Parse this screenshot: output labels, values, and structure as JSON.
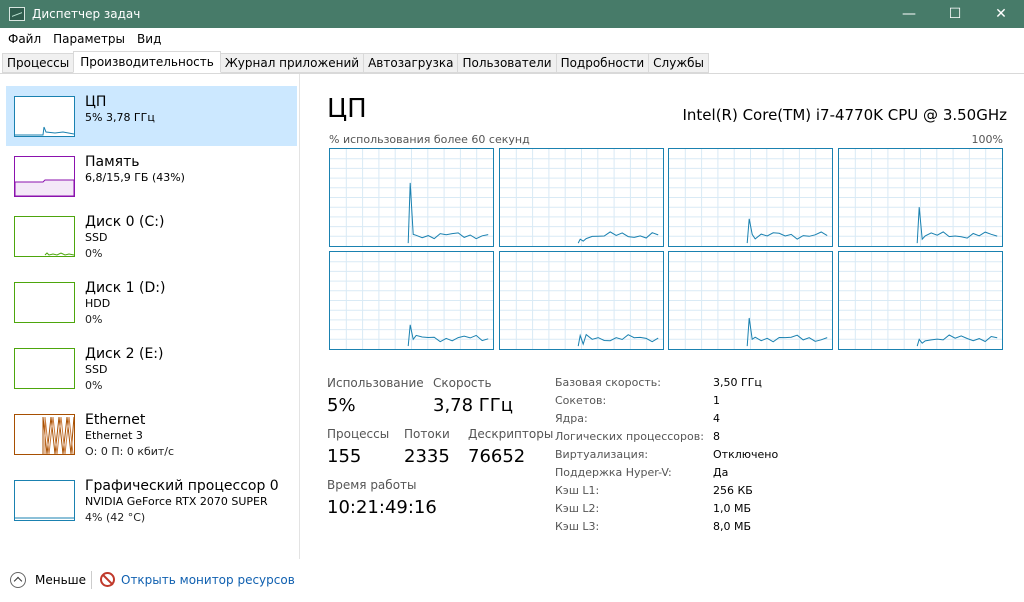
{
  "window": {
    "title": "Диспетчер задач",
    "minimize": "—",
    "maximize": "☐",
    "close": "✕"
  },
  "menu": [
    "Файл",
    "Параметры",
    "Вид"
  ],
  "tabs": [
    "Процессы",
    "Производительность",
    "Журнал приложений",
    "Автозагрузка",
    "Пользователи",
    "Подробности",
    "Службы"
  ],
  "active_tab": 1,
  "sidebar": [
    {
      "title": "ЦП",
      "sub": "5% 3,78 ГГц",
      "sub2": "",
      "color": "#1a81b0"
    },
    {
      "title": "Память",
      "sub": "6,8/15,9 ГБ (43%)",
      "sub2": "",
      "color": "#8b12ae"
    },
    {
      "title": "Диск 0 (C:)",
      "sub": "SSD",
      "sub2": "0%",
      "color": "#4da60c"
    },
    {
      "title": "Диск 1 (D:)",
      "sub": "HDD",
      "sub2": "0%",
      "color": "#4da60c"
    },
    {
      "title": "Диск 2 (E:)",
      "sub": "SSD",
      "sub2": "0%",
      "color": "#4da60c"
    },
    {
      "title": "Ethernet",
      "sub": "Ethernet 3",
      "sub2": "О: 0 П: 0 кбит/с",
      "color": "#a74f01"
    },
    {
      "title": "Графический процессор 0",
      "sub": "NVIDIA GeForce RTX 2070 SUPER",
      "sub2": "4% (42 °C)",
      "color": "#1a81b0"
    }
  ],
  "cpu": {
    "title": "ЦП",
    "model": "Intel(R) Core(TM) i7-4770K CPU @ 3.50GHz",
    "graph_caption": "% использования более 60 секунд",
    "graph_max": "100%",
    "usage_label": "Использование",
    "usage_value": "5%",
    "speed_label": "Скорость",
    "speed_value": "3,78 ГГц",
    "processes_label": "Процессы",
    "processes_value": "155",
    "threads_label": "Потоки",
    "threads_value": "2335",
    "handles_label": "Дескрипторы",
    "handles_value": "76652",
    "uptime_label": "Время работы",
    "uptime_value": "10:21:49:16",
    "specs": [
      {
        "label": "Базовая скорость:",
        "value": "3,50 ГГц"
      },
      {
        "label": "Сокетов:",
        "value": "1"
      },
      {
        "label": "Ядра:",
        "value": "4"
      },
      {
        "label": "Логических процессоров:",
        "value": "8"
      },
      {
        "label": "Виртуализация:",
        "value": "Отключено"
      },
      {
        "label": "Поддержка Hyper-V:",
        "value": "Да"
      },
      {
        "label": "Кэш L1:",
        "value": "256 КБ"
      },
      {
        "label": "Кэш L2:",
        "value": "1,0 МБ"
      },
      {
        "label": "Кэш L3:",
        "value": "8,0 МБ"
      }
    ]
  },
  "footer": {
    "less_label": "Меньше",
    "monitor_label": "Открыть монитор ресурсов"
  },
  "colors": {
    "cpu": "#1a81b0",
    "titlebar": "#477b69",
    "selected": "#cce8ff",
    "link": "#1060b0"
  }
}
